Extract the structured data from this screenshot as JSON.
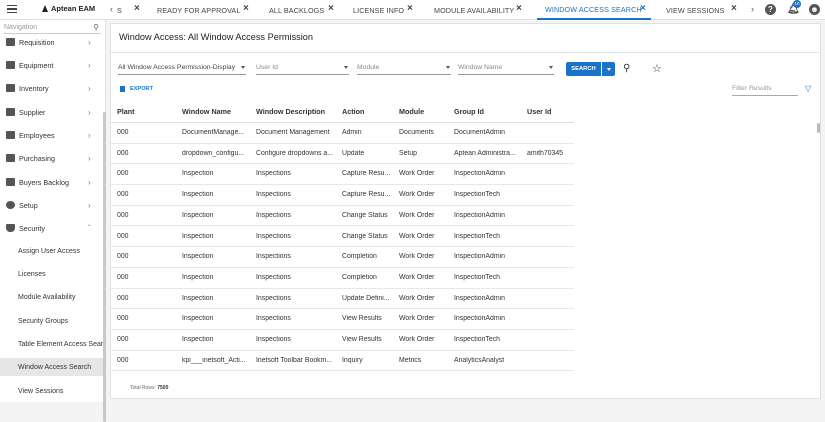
{
  "app": {
    "name": "Aptean EAM"
  },
  "tabs": [
    {
      "label": "S"
    },
    {
      "label": "READY FOR APPROVAL"
    },
    {
      "label": "ALL BACKLOGS"
    },
    {
      "label": "LICENSE INFO"
    },
    {
      "label": "MODULE AVAILABILITY"
    },
    {
      "label": "WINDOW ACCESS SEARCH",
      "active": true
    },
    {
      "label": "VIEW SESSIONS"
    }
  ],
  "topbar": {
    "help_icon": "?",
    "user_icon": "☻",
    "notification_count": "10"
  },
  "sidebar": {
    "search_placeholder": "Navigation",
    "items": [
      {
        "label": "Requisition",
        "icon": "cart-icon"
      },
      {
        "label": "Equipment",
        "icon": "truck-icon"
      },
      {
        "label": "Inventory",
        "icon": "box-icon"
      },
      {
        "label": "Supplier",
        "icon": "handshake-icon"
      },
      {
        "label": "Employees",
        "icon": "people-icon"
      },
      {
        "label": "Purchasing",
        "icon": "cart-icon"
      },
      {
        "label": "Buyers Backlog",
        "icon": "cart-icon"
      },
      {
        "label": "Setup",
        "icon": "gear-icon"
      },
      {
        "label": "Security",
        "icon": "shield-icon"
      }
    ],
    "sub_items": [
      {
        "label": "Assign User Access"
      },
      {
        "label": "Licenses"
      },
      {
        "label": "Module Availability"
      },
      {
        "label": "Security Groups"
      },
      {
        "label": "Table Element Access Search"
      },
      {
        "label": "Window Access Search",
        "active": true
      },
      {
        "label": "View Sessions"
      }
    ]
  },
  "main": {
    "title": "Window Access: All Window Access Permission",
    "filters": {
      "view": "All Window Access Permission-Display",
      "user_id_placeholder": "User Id",
      "module_placeholder": "Module",
      "window_name_placeholder": "Window Name"
    },
    "search_label": "SEARCH",
    "export_label": "EXPORT",
    "filter_results_placeholder": "Filter Results",
    "columns": [
      "Plant",
      "Window Name",
      "Window Description",
      "Action",
      "Module",
      "Group Id",
      "User Id"
    ],
    "rows": [
      [
        "000",
        "DocumentManage...",
        "Document Management",
        "Admin",
        "Documents",
        "DocumentAdmin",
        ""
      ],
      [
        "000",
        "dropdown_configu...",
        "Configure dropdowns a...",
        "Update",
        "Setup",
        "Aptean Administra...",
        "amith70345"
      ],
      [
        "000",
        "Inspection",
        "Inspections",
        "Capture Resu...",
        "Work Order",
        "InspectionAdmin",
        ""
      ],
      [
        "000",
        "Inspection",
        "Inspections",
        "Capture Resu...",
        "Work Order",
        "InspectionTech",
        ""
      ],
      [
        "000",
        "Inspection",
        "Inspections",
        "Change Status",
        "Work Order",
        "InspectionAdmin",
        ""
      ],
      [
        "000",
        "Inspection",
        "Inspections",
        "Change Status",
        "Work Order",
        "InspectionTech",
        ""
      ],
      [
        "000",
        "Inspection",
        "Inspections",
        "Completion",
        "Work Order",
        "InspectionAdmin",
        ""
      ],
      [
        "000",
        "Inspection",
        "Inspections",
        "Completion",
        "Work Order",
        "InspectionTech",
        ""
      ],
      [
        "000",
        "Inspection",
        "Inspections",
        "Update Defini...",
        "Work Order",
        "InspectionAdmin",
        ""
      ],
      [
        "000",
        "Inspection",
        "Inspections",
        "View Results",
        "Work Order",
        "InspectionAdmin",
        ""
      ],
      [
        "000",
        "Inspection",
        "Inspections",
        "View Results",
        "Work Order",
        "InspectionTech",
        ""
      ],
      [
        "000",
        "kpi___inetsoft_Acti...",
        "Inetsoft Toolbar Bookm...",
        "Inquiry",
        "Metrics",
        "AnalyticsAnalyst",
        ""
      ]
    ],
    "total_rows_label": "Total Rows:",
    "total_rows_value": "7500"
  },
  "colors": {
    "accent": "#1a73c9"
  }
}
